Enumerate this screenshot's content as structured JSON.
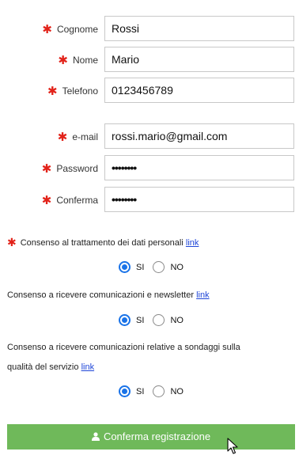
{
  "fields": [
    {
      "label": "Cognome",
      "value": "Rossi",
      "required": true
    },
    {
      "label": "Nome",
      "value": "Mario",
      "required": true
    },
    {
      "label": "Telefono",
      "value": "0123456789",
      "required": true
    },
    {
      "label": "e-mail",
      "value": "rossi.mario@gmail.com",
      "required": true
    },
    {
      "label": "Password",
      "value": "••••••••",
      "required": true
    },
    {
      "label": "Conferma",
      "value": "••••••••",
      "required": true
    }
  ],
  "required_mark": "✱",
  "consents": [
    {
      "text": "Consenso al trattamento dei dati personali",
      "text_line2": "",
      "link": "link",
      "required": true,
      "selected": "SI"
    },
    {
      "text": "Consenso a ricevere comunicazioni e newsletter",
      "text_line2": "",
      "link": "link",
      "required": false,
      "selected": "SI"
    },
    {
      "text": "Consenso a ricevere comunicazioni relative a sondaggi sulla",
      "text_line2": "qualità del servizio",
      "link": "link",
      "required": false,
      "selected": "SI"
    }
  ],
  "options": {
    "yes": "SI",
    "no": "NO"
  },
  "submit": {
    "label": "Conferma registrazione",
    "icon": "user-icon"
  },
  "colors": {
    "required": "#e2231a",
    "button": "#6fb95a",
    "link": "#1f46d8",
    "radio": "#1a73e8"
  }
}
